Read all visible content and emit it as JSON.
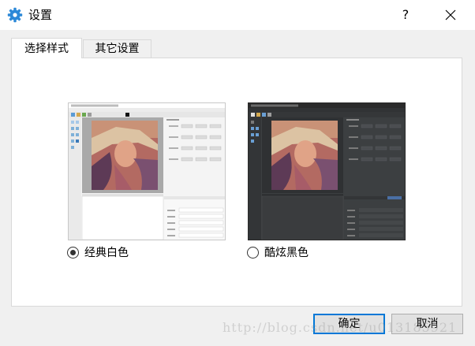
{
  "window": {
    "title": "设置",
    "help_label": "?"
  },
  "tabs": [
    {
      "label": "选择样式",
      "active": true
    },
    {
      "label": "其它设置",
      "active": false
    }
  ],
  "styles": {
    "light": {
      "label": "经典白色",
      "selected": true
    },
    "dark": {
      "label": "酷炫黑色",
      "selected": false
    }
  },
  "buttons": {
    "ok": "确定",
    "cancel": "取消"
  },
  "watermark": "http://blog.csdn.net/u013185921",
  "colors": {
    "accent": "#0078d7",
    "dark_theme_bg": "#3b3b3b",
    "light_theme_bg": "#f4f4f4"
  }
}
